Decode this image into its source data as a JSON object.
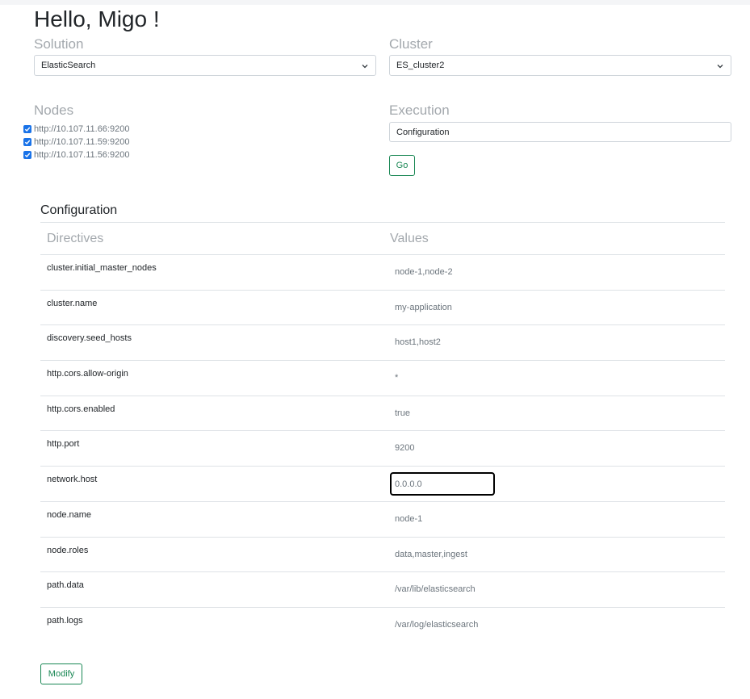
{
  "greeting": "Hello, Migo !",
  "solution": {
    "label": "Solution",
    "selected": "ElasticSearch"
  },
  "cluster": {
    "label": "Cluster",
    "selected": "ES_cluster2"
  },
  "nodes": {
    "label": "Nodes",
    "items": [
      {
        "url": "http://10.107.11.66:9200",
        "checked": true
      },
      {
        "url": "http://10.107.11.59:9200",
        "checked": true
      },
      {
        "url": "http://10.107.11.56:9200",
        "checked": true
      }
    ]
  },
  "execution": {
    "label": "Execution",
    "value": "Configuration",
    "go_label": "Go"
  },
  "configuration": {
    "title": "Configuration",
    "col_directives": "Directives",
    "col_values": "Values",
    "rows": [
      {
        "directive": "cluster.initial_master_nodes",
        "value": "node-1,node-2"
      },
      {
        "directive": "cluster.name",
        "value": "my-application"
      },
      {
        "directive": "discovery.seed_hosts",
        "value": "host1,host2"
      },
      {
        "directive": "http.cors.allow-origin",
        "value": "*"
      },
      {
        "directive": "http.cors.enabled",
        "value": "true"
      },
      {
        "directive": "http.port",
        "value": "9200"
      },
      {
        "directive": "network.host",
        "value": "0.0.0.0"
      },
      {
        "directive": "node.name",
        "value": "node-1"
      },
      {
        "directive": "node.roles",
        "value": "data,master,ingest"
      },
      {
        "directive": "path.data",
        "value": "/var/lib/elasticsearch"
      },
      {
        "directive": "path.logs",
        "value": "/var/log/elasticsearch"
      }
    ],
    "modify_label": "Modify"
  },
  "colors": {
    "accent": "#198754",
    "checkbox": "#1a73e8",
    "muted": "#a3a8ad"
  }
}
